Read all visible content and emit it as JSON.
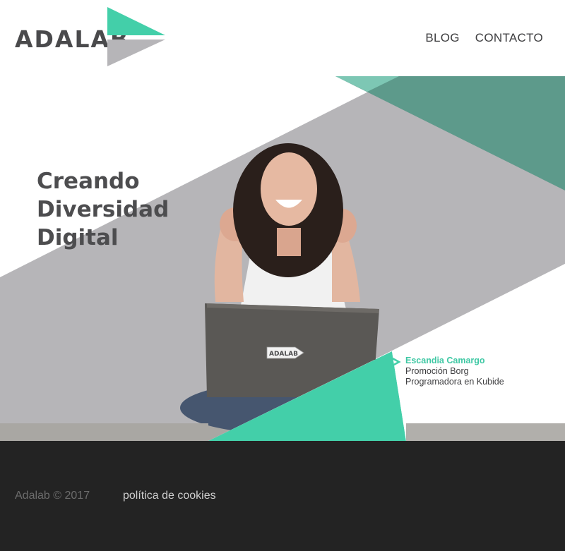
{
  "header": {
    "logo_text": "ADALAB",
    "nav": [
      {
        "label": "BLOG"
      },
      {
        "label": "CONTACTO"
      }
    ]
  },
  "hero": {
    "title_lines": [
      "Creando",
      "Diversidad",
      "Digital"
    ],
    "laptop_sticker": "ADALAB",
    "testimonial": {
      "name": "Escandia Camargo",
      "promotion": "Promoción Borg",
      "role": "Programadora en Kubide"
    }
  },
  "footer": {
    "copyright": "Adalab © 2017",
    "cookies_link": "política de cookies"
  },
  "colors": {
    "teal": "#43cfa9",
    "dark_teal": "#5d9a8b",
    "gray_band": "#b6b5b8",
    "text_dark": "#4d4d4f",
    "footer_bg": "#232323"
  }
}
